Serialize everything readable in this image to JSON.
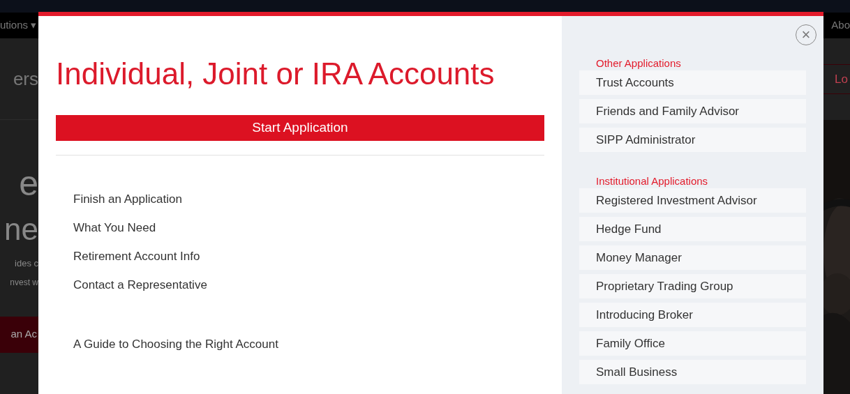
{
  "background_page": {
    "nav_left": "utions ▾",
    "nav_right": "Abo",
    "heading_fragment": "ers",
    "login_fragment": "Lo",
    "hero_line_1": "e",
    "hero_line_2": "ne",
    "body_line_1": "ides c",
    "body_line_2": "nvest w",
    "button_fragment": "an Ac"
  },
  "modal": {
    "title": "Individual, Joint or IRA Accounts",
    "primary_button": "Start Application",
    "link_groups": [
      [
        "Finish an Application",
        "What You Need",
        "Retirement Account Info",
        "Contact a Representative"
      ],
      [
        "A Guide to Choosing the Right Account"
      ]
    ],
    "close_label": "×",
    "sections": [
      {
        "heading": "Other Applications",
        "items": [
          "Trust Accounts",
          "Friends and Family Advisor",
          "SIPP Administrator"
        ]
      },
      {
        "heading": "Institutional Applications",
        "items": [
          "Registered Investment Advisor",
          "Hedge Fund",
          "Money Manager",
          "Proprietary Trading Group",
          "Introducing Broker",
          "Family Office",
          "Small Business"
        ]
      }
    ]
  }
}
